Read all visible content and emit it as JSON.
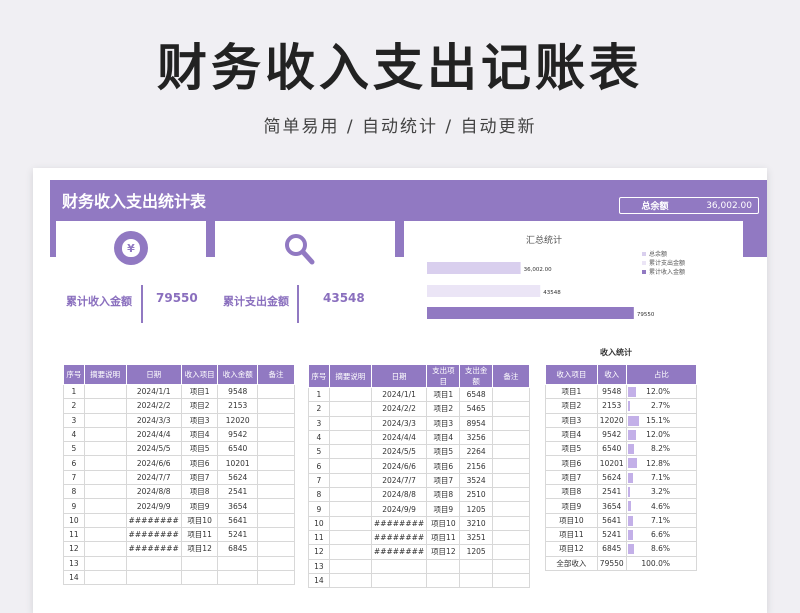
{
  "hero": {
    "title": "财务收入支出记账表",
    "subtitle": "简单易用   /   自动统计   /   自动更新"
  },
  "sheet": {
    "title": "财务收入支出统计表",
    "total_label": "总余额",
    "total_value": "36,002.00"
  },
  "cards": {
    "income_label": "累计收入金额",
    "income_value": "79550",
    "expense_label": "累计支出金额",
    "expense_value": "43548"
  },
  "colors": {
    "accent": "#9179c2",
    "light": "#d9cfee",
    "lighter": "#ebe5f6"
  },
  "icons": {
    "income": "money-bag-icon",
    "expense": "search-icon"
  },
  "chart_data": {
    "type": "bar",
    "title": "汇总统计",
    "orientation": "horizontal",
    "categories": [
      "总余额",
      "累计支出金额",
      "累计收入金额"
    ],
    "values": [
      36002.0,
      43548,
      79550
    ],
    "labels": [
      "36,002.00",
      "43548",
      "79550"
    ],
    "series_colors": [
      "#d9cfee",
      "#ebe5f6",
      "#9179c2"
    ],
    "xlim": [
      0,
      100000
    ],
    "legend_position": "right",
    "grid": false
  },
  "income_table": {
    "headers": [
      "序号",
      "摘要说明",
      "日期",
      "收入项目",
      "收入金额",
      "备注"
    ],
    "rows": [
      [
        "1",
        "",
        "2024/1/1",
        "项目1",
        "9548",
        ""
      ],
      [
        "2",
        "",
        "2024/2/2",
        "项目2",
        "2153",
        ""
      ],
      [
        "3",
        "",
        "2024/3/3",
        "项目3",
        "12020",
        ""
      ],
      [
        "4",
        "",
        "2024/4/4",
        "项目4",
        "9542",
        ""
      ],
      [
        "5",
        "",
        "2024/5/5",
        "项目5",
        "6540",
        ""
      ],
      [
        "6",
        "",
        "2024/6/6",
        "项目6",
        "10201",
        ""
      ],
      [
        "7",
        "",
        "2024/7/7",
        "项目7",
        "5624",
        ""
      ],
      [
        "8",
        "",
        "2024/8/8",
        "项目8",
        "2541",
        ""
      ],
      [
        "9",
        "",
        "2024/9/9",
        "项目9",
        "3654",
        ""
      ],
      [
        "10",
        "",
        "########",
        "项目10",
        "5641",
        ""
      ],
      [
        "11",
        "",
        "########",
        "项目11",
        "5241",
        ""
      ],
      [
        "12",
        "",
        "########",
        "项目12",
        "6845",
        ""
      ],
      [
        "13",
        "",
        "",
        "",
        "",
        ""
      ],
      [
        "14",
        "",
        "",
        "",
        "",
        ""
      ]
    ]
  },
  "expense_table": {
    "headers": [
      "序号",
      "摘要说明",
      "日期",
      "支出项目",
      "支出金额",
      "备注"
    ],
    "rows": [
      [
        "1",
        "",
        "2024/1/1",
        "项目1",
        "6548",
        ""
      ],
      [
        "2",
        "",
        "2024/2/2",
        "项目2",
        "5465",
        ""
      ],
      [
        "3",
        "",
        "2024/3/3",
        "项目3",
        "8954",
        ""
      ],
      [
        "4",
        "",
        "2024/4/4",
        "项目4",
        "3256",
        ""
      ],
      [
        "5",
        "",
        "2024/5/5",
        "项目5",
        "2264",
        ""
      ],
      [
        "6",
        "",
        "2024/6/6",
        "项目6",
        "2156",
        ""
      ],
      [
        "7",
        "",
        "2024/7/7",
        "项目7",
        "3524",
        ""
      ],
      [
        "8",
        "",
        "2024/8/8",
        "项目8",
        "2510",
        ""
      ],
      [
        "9",
        "",
        "2024/9/9",
        "项目9",
        "1205",
        ""
      ],
      [
        "10",
        "",
        "########",
        "项目10",
        "3210",
        ""
      ],
      [
        "11",
        "",
        "########",
        "项目11",
        "3251",
        ""
      ],
      [
        "12",
        "",
        "########",
        "项目12",
        "1205",
        ""
      ],
      [
        "13",
        "",
        "",
        "",
        "",
        ""
      ],
      [
        "14",
        "",
        "",
        "",
        "",
        ""
      ]
    ]
  },
  "stats_table": {
    "title": "收入统计",
    "headers": [
      "收入项目",
      "收入",
      "占比"
    ],
    "rows": [
      [
        "项目1",
        "9548",
        "12.0%"
      ],
      [
        "项目2",
        "2153",
        "2.7%"
      ],
      [
        "项目3",
        "12020",
        "15.1%"
      ],
      [
        "项目4",
        "9542",
        "12.0%"
      ],
      [
        "项目5",
        "6540",
        "8.2%"
      ],
      [
        "项目6",
        "10201",
        "12.8%"
      ],
      [
        "项目7",
        "5624",
        "7.1%"
      ],
      [
        "项目8",
        "2541",
        "3.2%"
      ],
      [
        "项目9",
        "3654",
        "4.6%"
      ],
      [
        "项目10",
        "5641",
        "7.1%"
      ],
      [
        "项目11",
        "5241",
        "6.6%"
      ],
      [
        "项目12",
        "6845",
        "8.6%"
      ],
      [
        "全部收入",
        "79550",
        "100.0%"
      ]
    ],
    "shares": [
      0.12,
      0.027,
      0.151,
      0.12,
      0.082,
      0.128,
      0.071,
      0.032,
      0.046,
      0.071,
      0.066,
      0.086,
      0
    ]
  }
}
